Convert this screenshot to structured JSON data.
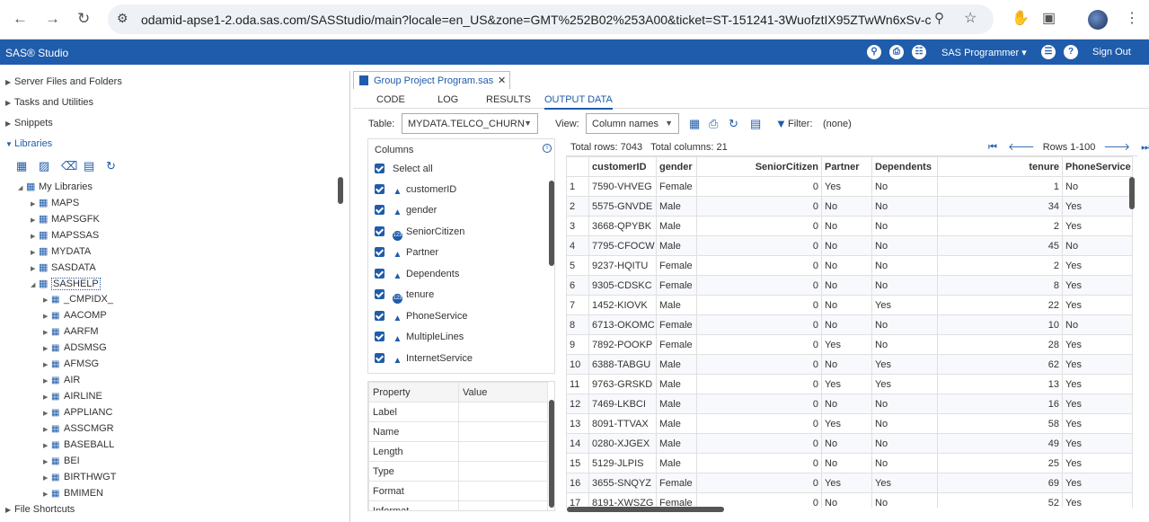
{
  "browser": {
    "url": "odamid-apse1-2.oda.sas.com/SASStudio/main?locale=en_US&zone=GMT%252B02%253A00&ticket=ST-151241-3WuofztIX95ZTwWn6xSv-c..."
  },
  "banner": {
    "app_title": "SAS® Studio",
    "perspective": "SAS Programmer ▾",
    "sign_out": "Sign Out"
  },
  "nav": {
    "server_files": "Server Files and Folders",
    "tasks": "Tasks and Utilities",
    "snippets": "Snippets",
    "libraries": "Libraries",
    "file_shortcuts": "File Shortcuts",
    "my_libraries": "My Libraries",
    "libs": [
      "MAPS",
      "MAPSGFK",
      "MAPSSAS",
      "MYDATA",
      "SASDATA",
      "SASHELP"
    ],
    "sashelp_tables": [
      "_CMPIDX_",
      "AACOMP",
      "AARFM",
      "ADSMSG",
      "AFMSG",
      "AIR",
      "AIRLINE",
      "APPLIANC",
      "ASSCMGR",
      "BASEBALL",
      "BEI",
      "BIRTHWGT",
      "BMIMEN"
    ]
  },
  "editor": {
    "file_tab": "Group Project Program.sas",
    "close": "✕",
    "tabs": [
      "CODE",
      "LOG",
      "RESULTS",
      "OUTPUT DATA"
    ]
  },
  "toolbar": {
    "table_label": "Table:",
    "table_value": "MYDATA.TELCO_CHURN",
    "view_label": "View:",
    "view_value": "Column names",
    "filter_label": "Filter:",
    "filter_value": "(none)"
  },
  "columns_panel": {
    "title": "Columns",
    "select_all": "Select all",
    "items": [
      {
        "name": "customerID",
        "type": "char"
      },
      {
        "name": "gender",
        "type": "char"
      },
      {
        "name": "SeniorCitizen",
        "type": "num"
      },
      {
        "name": "Partner",
        "type": "char"
      },
      {
        "name": "Dependents",
        "type": "char"
      },
      {
        "name": "tenure",
        "type": "num"
      },
      {
        "name": "PhoneService",
        "type": "char"
      },
      {
        "name": "MultipleLines",
        "type": "char"
      },
      {
        "name": "InternetService",
        "type": "char"
      }
    ]
  },
  "properties_panel": {
    "headers": [
      "Property",
      "Value"
    ],
    "rows": [
      "Label",
      "Name",
      "Length",
      "Type",
      "Format",
      "Informat"
    ]
  },
  "grid": {
    "total_rows": "Total rows: 7043",
    "total_columns": "Total columns: 21",
    "rows_range": "Rows 1-100",
    "headers": [
      "",
      "customerID",
      "gender",
      "SeniorCitizen",
      "Partner",
      "Dependents",
      "tenure",
      "PhoneService"
    ],
    "rows": [
      [
        "1",
        "7590-VHVEG",
        "Female",
        "0",
        "Yes",
        "No",
        "1",
        "No"
      ],
      [
        "2",
        "5575-GNVDE",
        "Male",
        "0",
        "No",
        "No",
        "34",
        "Yes"
      ],
      [
        "3",
        "3668-QPYBK",
        "Male",
        "0",
        "No",
        "No",
        "2",
        "Yes"
      ],
      [
        "4",
        "7795-CFOCW",
        "Male",
        "0",
        "No",
        "No",
        "45",
        "No"
      ],
      [
        "5",
        "9237-HQITU",
        "Female",
        "0",
        "No",
        "No",
        "2",
        "Yes"
      ],
      [
        "6",
        "9305-CDSKC",
        "Female",
        "0",
        "No",
        "No",
        "8",
        "Yes"
      ],
      [
        "7",
        "1452-KIOVK",
        "Male",
        "0",
        "No",
        "Yes",
        "22",
        "Yes"
      ],
      [
        "8",
        "6713-OKOMC",
        "Female",
        "0",
        "No",
        "No",
        "10",
        "No"
      ],
      [
        "9",
        "7892-POOKP",
        "Female",
        "0",
        "Yes",
        "No",
        "28",
        "Yes"
      ],
      [
        "10",
        "6388-TABGU",
        "Male",
        "0",
        "No",
        "Yes",
        "62",
        "Yes"
      ],
      [
        "11",
        "9763-GRSKD",
        "Male",
        "0",
        "Yes",
        "Yes",
        "13",
        "Yes"
      ],
      [
        "12",
        "7469-LKBCI",
        "Male",
        "0",
        "No",
        "No",
        "16",
        "Yes"
      ],
      [
        "13",
        "8091-TTVAX",
        "Male",
        "0",
        "Yes",
        "No",
        "58",
        "Yes"
      ],
      [
        "14",
        "0280-XJGEX",
        "Male",
        "0",
        "No",
        "No",
        "49",
        "Yes"
      ],
      [
        "15",
        "5129-JLPIS",
        "Male",
        "0",
        "No",
        "No",
        "25",
        "Yes"
      ],
      [
        "16",
        "3655-SNQYZ",
        "Female",
        "0",
        "Yes",
        "Yes",
        "69",
        "Yes"
      ],
      [
        "17",
        "8191-XWSZG",
        "Female",
        "0",
        "No",
        "No",
        "52",
        "Yes"
      ]
    ]
  }
}
